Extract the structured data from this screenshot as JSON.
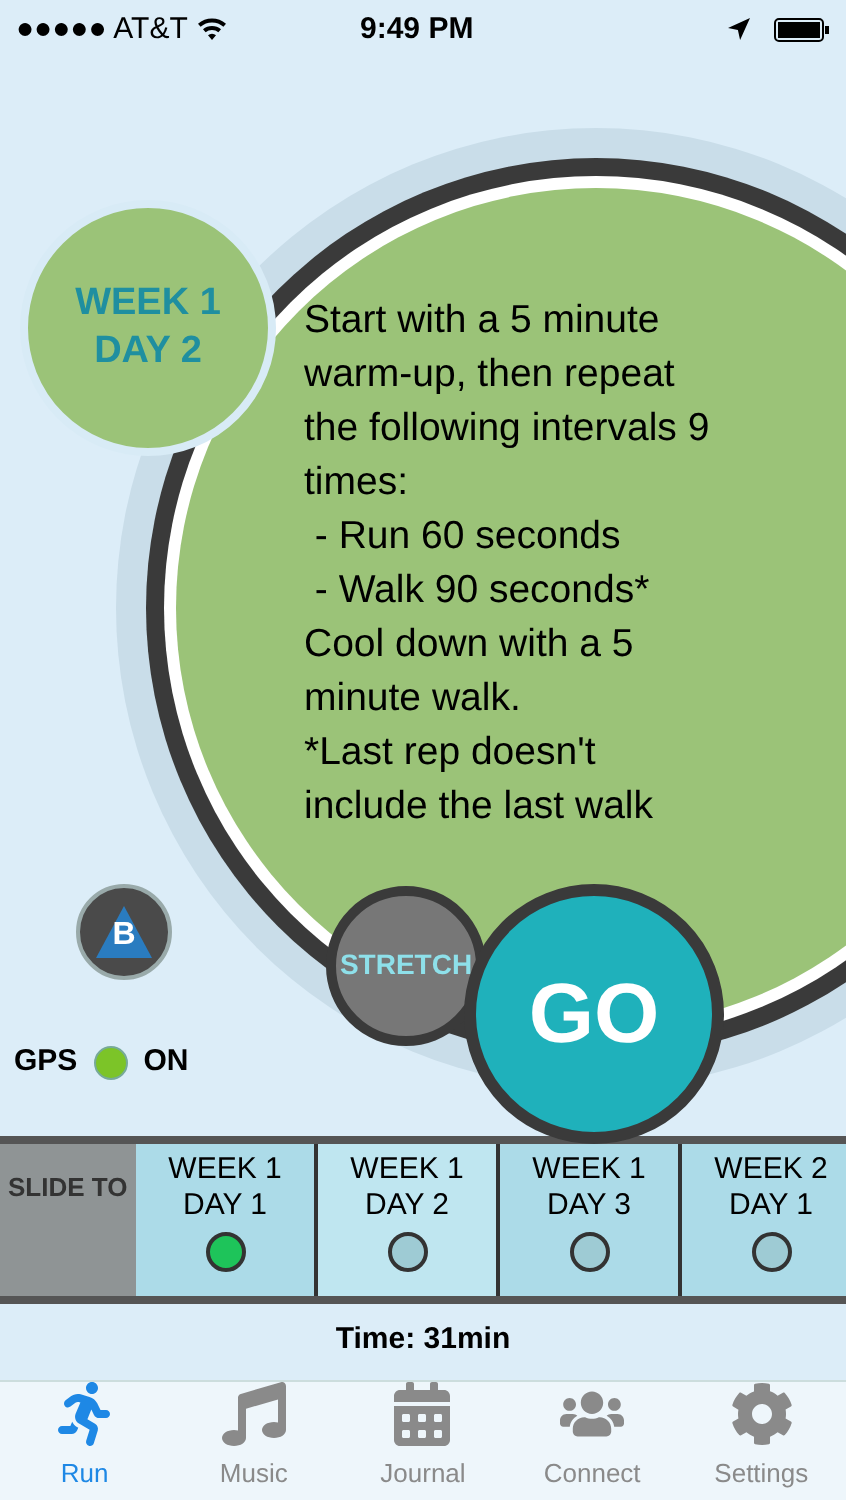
{
  "status_bar": {
    "carrier": "●●●●● AT&T",
    "time": "9:49 PM"
  },
  "workout": {
    "week": "WEEK 1",
    "day": "DAY 2",
    "lines": [
      "Start with a 5 minute",
      "warm-up, then repeat",
      "the following intervals 9",
      "times:",
      " - Run 60 seconds",
      " - Walk 90 seconds*",
      "Cool down with a 5",
      "minute walk.",
      "*Last rep doesn't",
      "include the last walk"
    ]
  },
  "stretch_button": "STRETCH",
  "go_button": "GO",
  "brand_button": "B",
  "gps": {
    "label": "GPS",
    "on": true,
    "state": "ON"
  },
  "slider": {
    "label": "SLIDE TO",
    "days": [
      {
        "week": "WEEK 1",
        "day": "DAY 1",
        "completed": true,
        "selected": false
      },
      {
        "week": "WEEK 1",
        "day": "DAY 2",
        "completed": false,
        "selected": true
      },
      {
        "week": "WEEK 1",
        "day": "DAY 3",
        "completed": false,
        "selected": false
      },
      {
        "week": "WEEK 2",
        "day": "DAY 1",
        "completed": false,
        "selected": false
      }
    ]
  },
  "time": "Time: 31min",
  "tabs": [
    {
      "label": "Run",
      "kind": "run",
      "selected": true
    },
    {
      "label": "Music",
      "kind": "music",
      "selected": false
    },
    {
      "label": "Journal",
      "kind": "journal",
      "selected": false
    },
    {
      "label": "Connect",
      "kind": "connect",
      "selected": false
    },
    {
      "label": "Settings",
      "kind": "settings",
      "selected": false
    }
  ]
}
